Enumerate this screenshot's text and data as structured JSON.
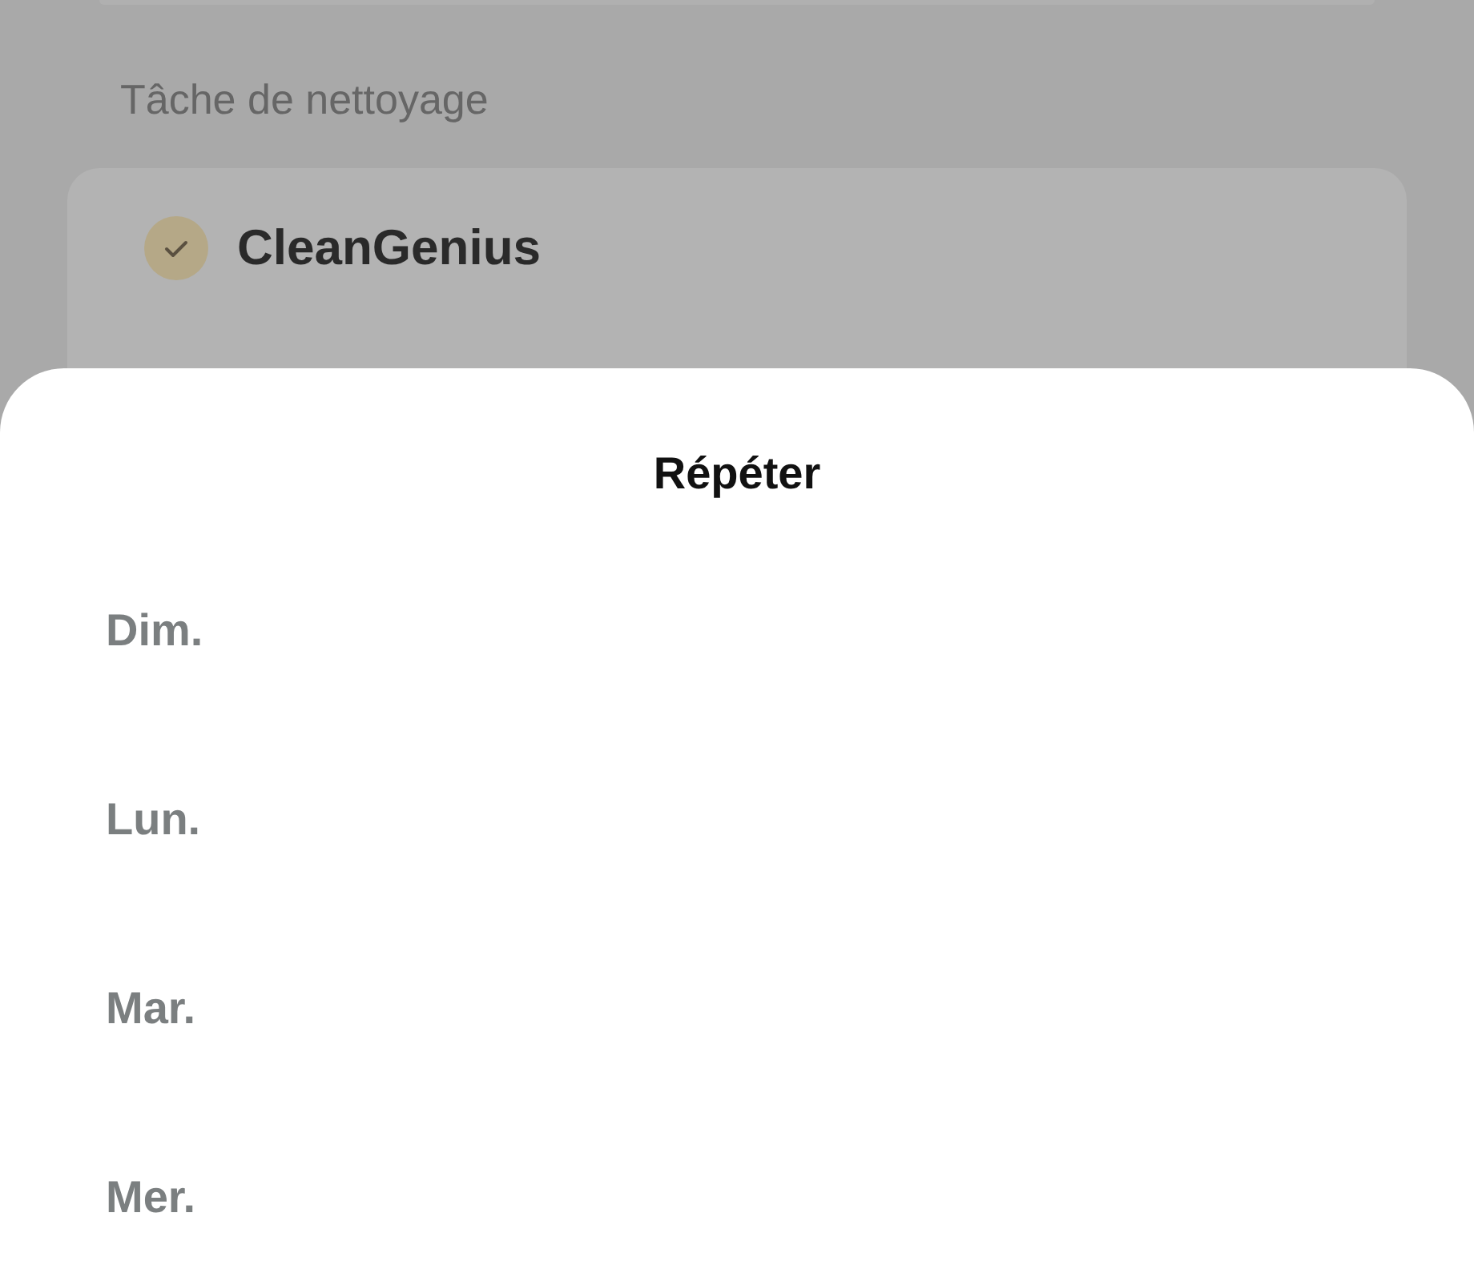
{
  "section_label": "Tâche de nettoyage",
  "task": {
    "label": "CleanGenius",
    "checked": true
  },
  "sheet": {
    "title": "Répéter",
    "days": [
      {
        "label": "Dim.",
        "selected": false
      },
      {
        "label": "Lun.",
        "selected": false
      },
      {
        "label": "Mar.",
        "selected": false
      },
      {
        "label": "Mer.",
        "selected": false
      }
    ]
  }
}
